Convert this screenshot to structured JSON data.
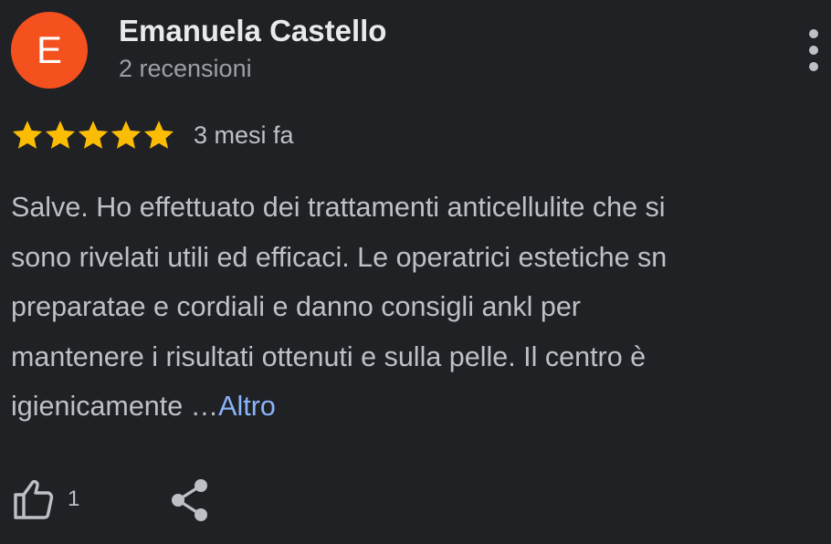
{
  "author": {
    "initial": "E",
    "name": "Emanuela Castello",
    "review_count": "2 recensioni",
    "avatar_color": "#f4511e"
  },
  "rating": {
    "stars": 5,
    "max": 5,
    "date": "3 mesi fa",
    "star_color": "#fbbc04"
  },
  "review": {
    "lines": [
      "Salve. Ho effettuato dei trattamenti anticellulite che si",
      "sono rivelati utili ed efficaci. Le operatrici estetiche sn",
      "preparatae e cordiali e danno consigli ankl per",
      "mantenere i risultati ottenuti e sulla pelle. Il centro è",
      "igienicamente …"
    ],
    "more_label": "Altro",
    "link_color": "#8ab4f8"
  },
  "actions": {
    "like_count": "1",
    "like_icon": "thumb-up-icon",
    "share_icon": "share-icon",
    "menu_icon": "more-vert-icon"
  },
  "theme": {
    "background": "#202124",
    "text_primary": "#e8eaed",
    "text_secondary": "#bdc1c6"
  }
}
